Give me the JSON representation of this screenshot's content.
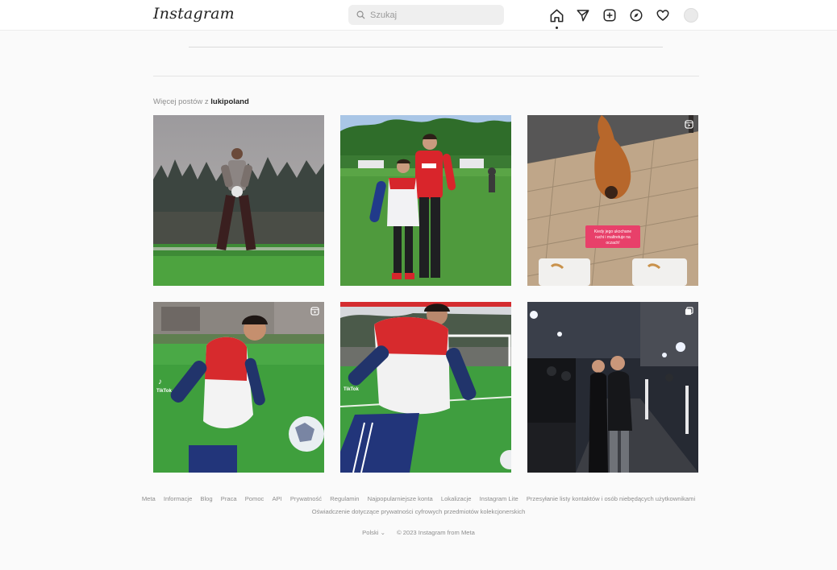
{
  "header": {
    "logo_text": "Instagram",
    "search_placeholder": "Szukaj",
    "icons": [
      "home-icon",
      "direct-message-icon",
      "new-post-icon",
      "explore-icon",
      "activity-heart-icon",
      "profile-avatar"
    ]
  },
  "more_posts": {
    "prefix": "Więcej postów z",
    "username": "lukipoland"
  },
  "posts": [
    {
      "name": "post-1",
      "badge": "none"
    },
    {
      "name": "post-2",
      "badge": "none"
    },
    {
      "name": "post-3",
      "badge": "reel-icon",
      "caption": "Kiedy jego ukochane ruchi i maltretuje na oczach!"
    },
    {
      "name": "post-4",
      "badge": "reel-icon",
      "watermark": "TikTok"
    },
    {
      "name": "post-5",
      "badge": "none",
      "watermark": "TikTok"
    },
    {
      "name": "post-6",
      "badge": "carousel-icon"
    }
  ],
  "footer": {
    "links": [
      "Meta",
      "Informacje",
      "Blog",
      "Praca",
      "Pomoc",
      "API",
      "Prywatność",
      "Regulamin",
      "Najpopularniejsze konta",
      "Lokalizacje",
      "Instagram Lite",
      "Przesyłanie listy kontaktów i osób niebędących użytkownikami"
    ],
    "line2": "Oświadczenie dotyczące prywatności cyfrowych przedmiotów kolekcjonerskich",
    "language": "Polski",
    "copyright": "© 2023 Instagram from Meta"
  },
  "colors": {
    "background": "#fafafa",
    "text_primary": "#262626",
    "text_secondary": "#8e8e8e",
    "divider": "#dbdbdb"
  }
}
